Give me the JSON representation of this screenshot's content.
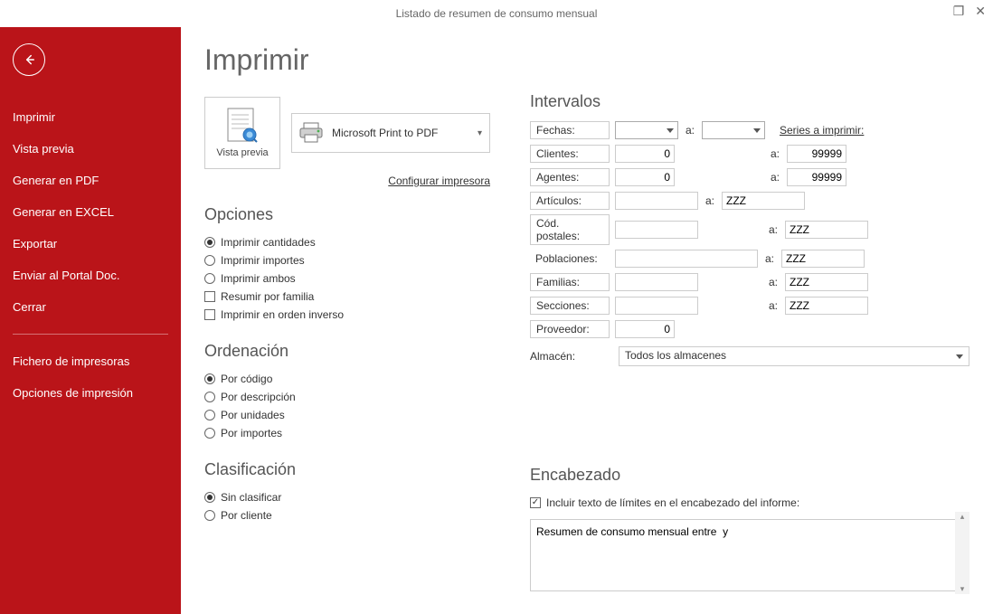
{
  "window": {
    "title": "Listado de resumen de consumo mensual"
  },
  "sidebar": {
    "items": [
      "Imprimir",
      "Vista previa",
      "Generar en PDF",
      "Generar en EXCEL",
      "Exportar",
      "Enviar al Portal Doc.",
      "Cerrar"
    ],
    "items2": [
      "Fichero de impresoras",
      "Opciones de impresión"
    ]
  },
  "page": {
    "title": "Imprimir",
    "preview_label": "Vista previa",
    "printer_name": "Microsoft Print to PDF",
    "configure_printer": "Configurar impresora"
  },
  "opciones": {
    "heading": "Opciones",
    "items": [
      {
        "label": "Imprimir cantidades",
        "type": "radio",
        "checked": true
      },
      {
        "label": "Imprimir importes",
        "type": "radio",
        "checked": false
      },
      {
        "label": "Imprimir ambos",
        "type": "radio",
        "checked": false
      },
      {
        "label": "Resumir por familia",
        "type": "check",
        "checked": false
      },
      {
        "label": "Imprimir en orden inverso",
        "type": "check",
        "checked": false
      }
    ]
  },
  "ordenacion": {
    "heading": "Ordenación",
    "items": [
      {
        "label": "Por código",
        "checked": true
      },
      {
        "label": "Por descripción",
        "checked": false
      },
      {
        "label": "Por unidades",
        "checked": false
      },
      {
        "label": "Por importes",
        "checked": false
      }
    ]
  },
  "clasificacion": {
    "heading": "Clasificación",
    "items": [
      {
        "label": "Sin clasificar",
        "checked": true
      },
      {
        "label": "Por cliente",
        "checked": false
      }
    ]
  },
  "intervalos": {
    "heading": "Intervalos",
    "series_link": "Series a imprimir:",
    "a_label": "a:",
    "rows": {
      "fechas": {
        "label": "Fechas:",
        "from": "",
        "to": ""
      },
      "clientes": {
        "label": "Clientes:",
        "from": "0",
        "to": "99999"
      },
      "agentes": {
        "label": "Agentes:",
        "from": "0",
        "to": "99999"
      },
      "articulos": {
        "label": "Artículos:",
        "from": "",
        "to": "ZZZ"
      },
      "cpostales": {
        "label": "Cód. postales:",
        "from": "",
        "to": "ZZZ"
      },
      "poblaciones": {
        "label": "Poblaciones:",
        "from": "",
        "to": "ZZZ"
      },
      "familias": {
        "label": "Familias:",
        "from": "",
        "to": "ZZZ"
      },
      "secciones": {
        "label": "Secciones:",
        "from": "",
        "to": "ZZZ"
      },
      "proveedor": {
        "label": "Proveedor:",
        "from": "0"
      }
    },
    "almacen_label": "Almacén:",
    "almacen_value": "Todos los almacenes"
  },
  "encabezado": {
    "heading": "Encabezado",
    "check_label": "Incluir texto de límites en el encabezado del informe:",
    "check_checked": true,
    "text": "Resumen de consumo mensual entre  y"
  }
}
